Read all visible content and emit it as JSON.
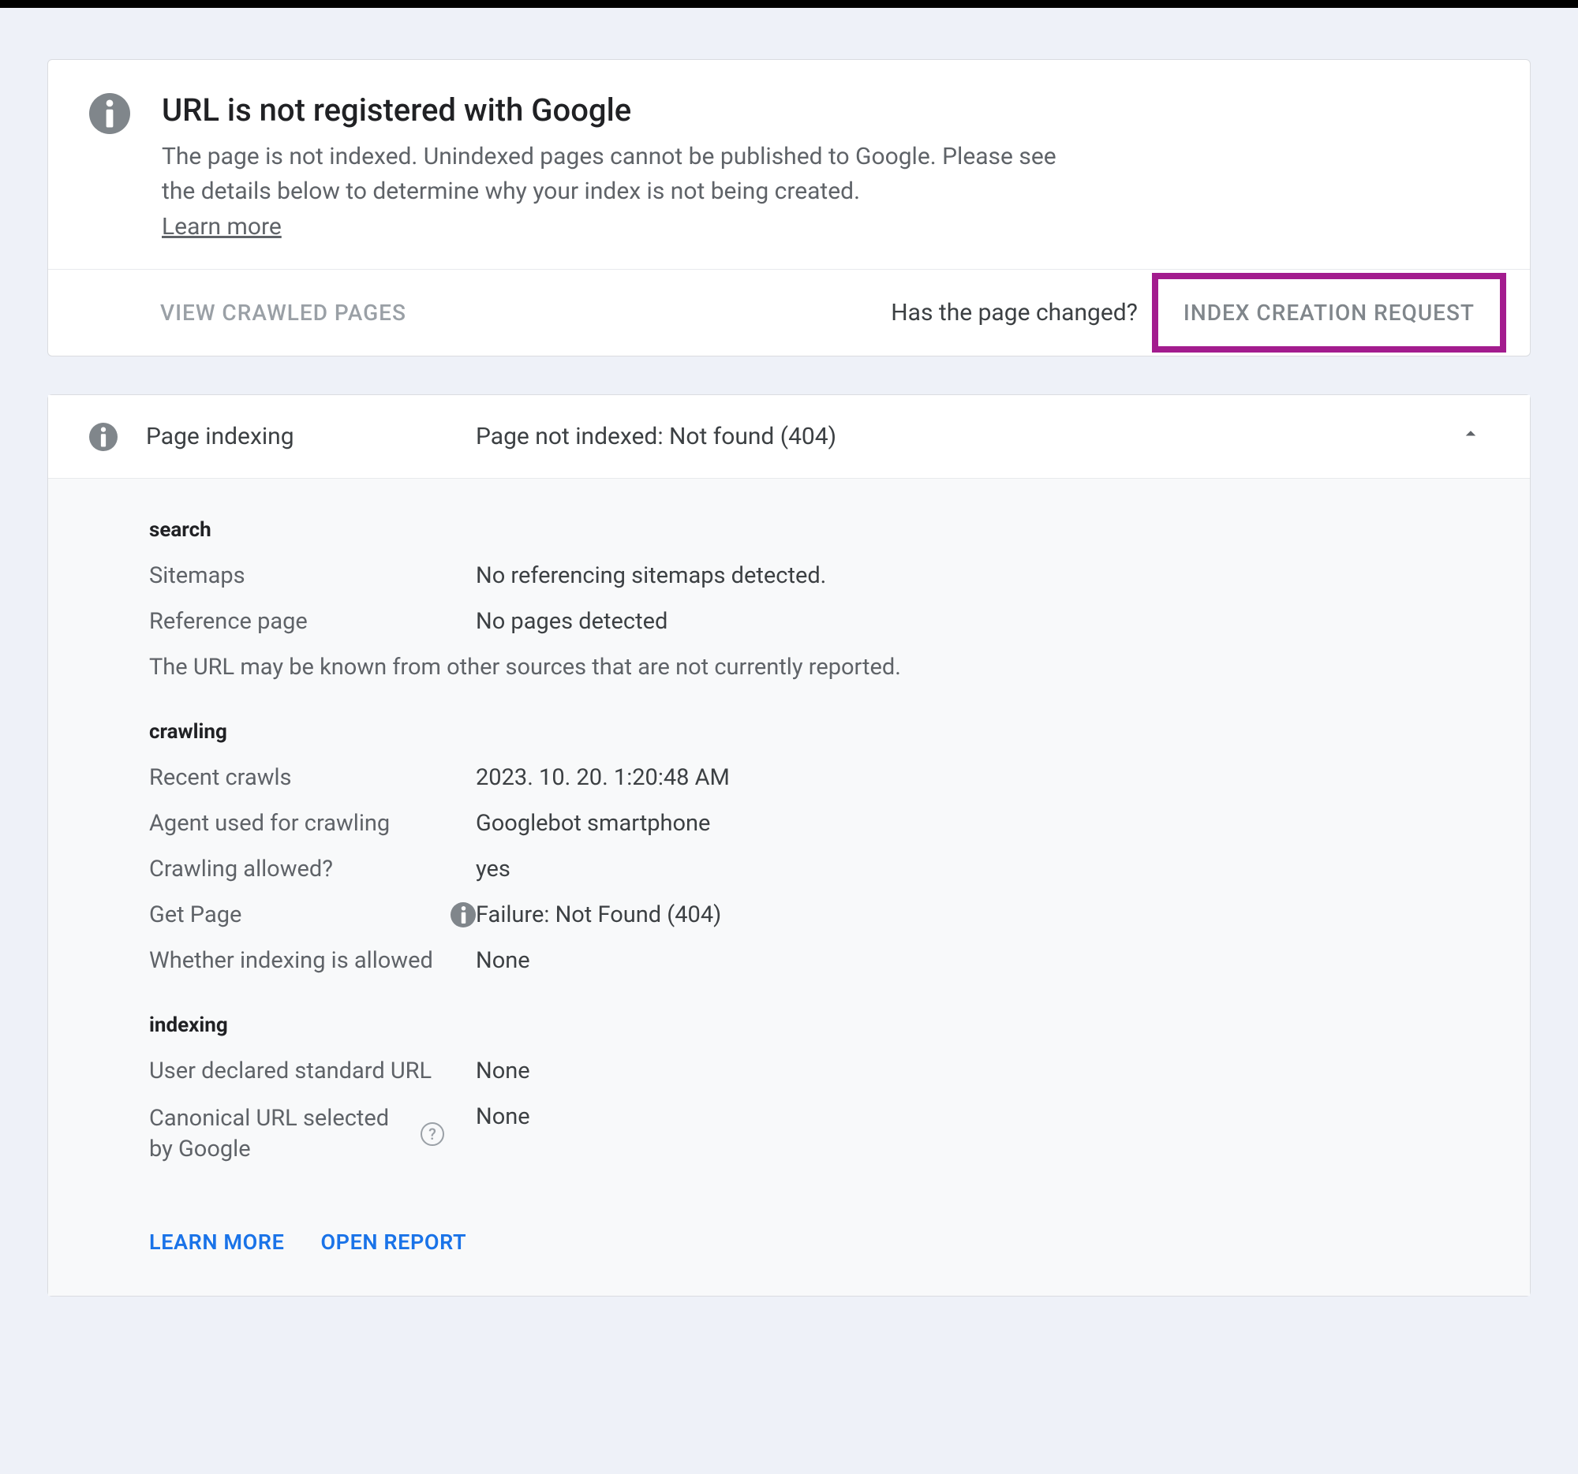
{
  "header": {
    "title": "URL is not registered with Google",
    "desc": "The page is not indexed. Unindexed pages cannot be published to Google. Please see the details below to determine why your index is not being created.",
    "learn_more": "Learn more"
  },
  "actions": {
    "view_crawled": "VIEW CRAWLED PAGES",
    "changed_q": "Has the page changed?",
    "index_request": "INDEX CREATION REQUEST"
  },
  "panel": {
    "title": "Page indexing",
    "status": "Page not indexed: Not found (404)"
  },
  "sections": {
    "search": {
      "heading": "search",
      "sitemaps_label": "Sitemaps",
      "sitemaps_value": "No referencing sitemaps detected.",
      "refpage_label": "Reference page",
      "refpage_value": "No pages detected",
      "note": "The URL may be known from other sources that are not currently reported."
    },
    "crawling": {
      "heading": "crawling",
      "recent_label": "Recent crawls",
      "recent_value": "2023. 10. 20. 1:20:48 AM",
      "agent_label": "Agent used for crawling",
      "agent_value": "Googlebot smartphone",
      "allowed_label": "Crawling allowed?",
      "allowed_value": "yes",
      "get_label": "Get Page",
      "get_value": "Failure: Not Found (404)",
      "indexing_allowed_label": "Whether indexing is allowed",
      "indexing_allowed_value": "None"
    },
    "indexing": {
      "heading": "indexing",
      "user_canon_label": "User declared standard URL",
      "user_canon_value": "None",
      "google_canon_label": "Canonical URL selected by Google",
      "google_canon_value": "None"
    }
  },
  "footer": {
    "learn_more": "LEARN MORE",
    "open_report": "OPEN REPORT"
  }
}
